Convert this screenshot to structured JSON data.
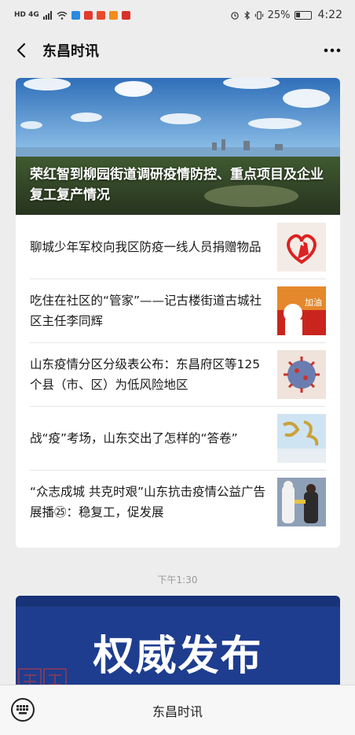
{
  "status_bar": {
    "network": "HD 4G",
    "battery": "25%",
    "time": "4:22"
  },
  "header": {
    "title": "东昌时讯",
    "back_icon": "chevron-left-icon",
    "more_icon": "more-dots-icon"
  },
  "hero": {
    "title": "荣红智到柳园街道调研疫情防控、重点项目及企业复工复产情况"
  },
  "articles": [
    {
      "title": "聊城少年军校向我区防疫一线人员捐赠物品",
      "thumb_icon": "heart-hand-icon"
    },
    {
      "title": "吃住在社区的“管家”——记古楼街道古城社区主任李同辉",
      "thumb_icon": "doctor-cheer-icon"
    },
    {
      "title": "山东疫情分区分级表公布：东昌府区等125个县（市、区）为低风险地区",
      "thumb_icon": "virus-icon"
    },
    {
      "title": "战“疫”考场，山东交出了怎样的“答卷”",
      "thumb_icon": "calligraphy-icon"
    },
    {
      "title": "“众志成城 共克时艰”山东抗击疫情公益广告展播㉕：稳复工，促发展",
      "thumb_icon": "workers-photo-icon"
    }
  ],
  "timestamp": "下午1:30",
  "banner": {
    "title": "权威发布"
  },
  "bottom_bar": {
    "title": "东昌时讯",
    "keyboard_icon": "keyboard-icon"
  },
  "colors": {
    "background": "#ededed",
    "banner_blue": "#1e3d8f",
    "card": "#ffffff"
  }
}
